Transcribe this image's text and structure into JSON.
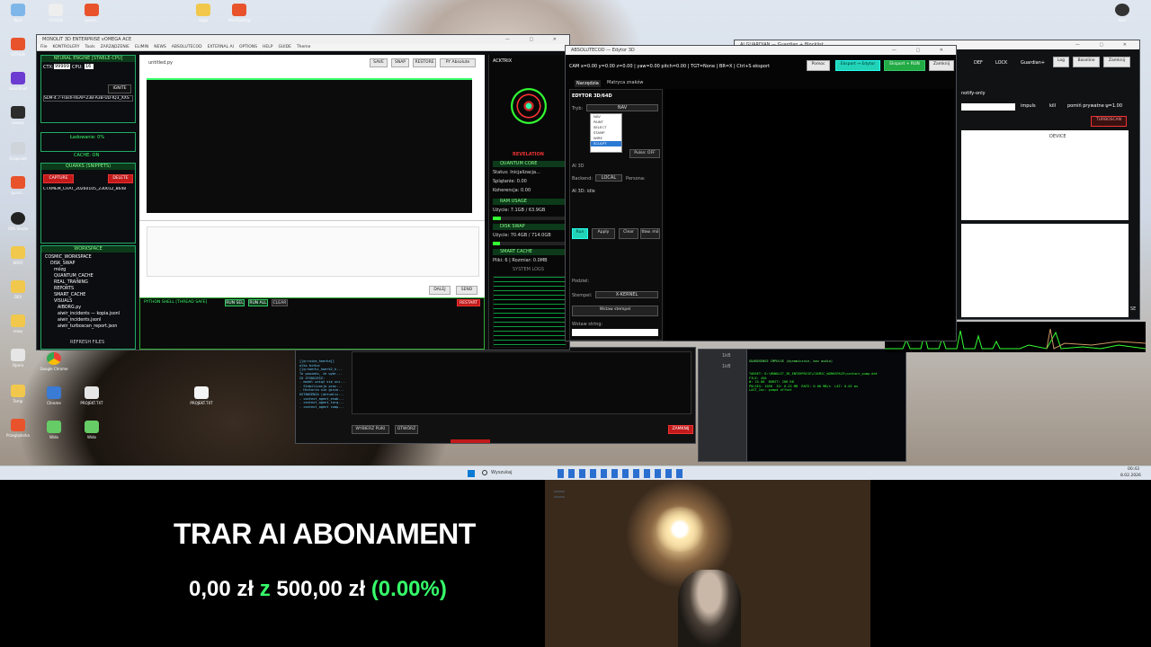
{
  "desktop": {
    "icons": [
      "Kosz",
      "GITHUB",
      "guard...",
      "Gaga",
      "ShortSetting",
      "GuardFuel",
      "aiwasp",
      "Snapcode",
      "OBS Studio",
      "KODY",
      "DEV",
      "nowy",
      "Opera",
      "Google Chrome",
      "Chrome",
      "Temp",
      "PROJEKT.TXT",
      "Wido",
      "Przeglądarka"
    ],
    "file_label": "PROJEKT.TXT"
  },
  "ide": {
    "title": "MONOLIT 3D ENTERPRISE vOMEGA ACE",
    "menu": [
      "File",
      "KONTROLERY",
      "Tools",
      "ZARZĄDZENIE",
      "ELIMIN",
      "NEWS",
      "ABSOLUTECOD",
      "EXTERNAL AI",
      "OPTIONS",
      "HELP",
      "GUIDE",
      "Theme"
    ],
    "engine_title": "NEURAL ENGINE [STABLE-CPU]",
    "ctx_label": "CTX:",
    "ctx_value": "99999",
    "cpu_label": "CPU:",
    "cpu_value": "16",
    "model": "SLM-4.7-Flash-REAP-23B-A3B-UD-IQ3_XXS",
    "ignite": "IGNITE",
    "loading": "Ładowanie: 0%",
    "cache": "CACHE: ON",
    "quarks": "QUARKS (SNIPPETS)",
    "capture": "CAPTURE",
    "delete": "DELETE",
    "snippet": "CTXMEM_CHAT_20260105_230012_8648",
    "workspace": "WORKSPACE",
    "tree": [
      "COSMIC_WORKSPACE",
      "DISK_SWAP",
      "mózg",
      "QUANTUM_CACHE",
      "REAL_TRAINING",
      "REPORTS",
      "SMART_CACHE",
      "VISUALS",
      "AIBORG.py",
      "aiwir_incidents — kopia.jsonl",
      "aiwir_incidents.jsonl",
      "aiwir_turboscan_report.json"
    ],
    "refresh": "REFRESH FILES",
    "file_tab": "untitled.py",
    "save": "SAVE",
    "snap": "SNAP",
    "restore": "RESTORE",
    "py_absolute": "PY Absolute",
    "dalej": "DALEJ",
    "send": "SEND",
    "shell_title": "PYTHON SHELL [THREAD SAFE]",
    "run_sel": "RUN SEL",
    "run_all": "RUN ALL",
    "clear": "CLEAR",
    "restart": "RESTART"
  },
  "monitor": {
    "acktrix": "ACKTRIX",
    "revelation": "REVELATION",
    "qcore": "QUANTUM CORE",
    "status": "Status: Inicjalizacja...",
    "splatanie": "Splątanie: 0.00",
    "koherencja": "Koherencja: 0.00",
    "ram": "RAM USAGE",
    "ram_val": "Użycie: 7.1GB / 63.9GB",
    "disk": "DISK SWAP",
    "disk_val": "Użycie: 70.4GB / 714.0GB",
    "smart": "SMART CACHE",
    "smart_val": "Pliki: 6 | Rozmiar: 0.0MB",
    "logs": "SYSTEM LOGS"
  },
  "editor3d": {
    "title": "ABSOLUTECOD — Edytor 3D",
    "status": "CAM x=0.00 y=0.00 z=0.00 | yaw=0.00 pitch=0.00 | TGT=None | BR=X | Ctrl+S eksport",
    "pomoc": "Pomoc",
    "eksport": "Eksport → Edytor",
    "eksport_run": "Eksport + RUN",
    "zamknij": "Zamknij",
    "tab1": "Narzędzia",
    "tab2": "Matryca znaków",
    "panel_title": "EDYTOR 3D/64D",
    "tryb": "Tryb:",
    "tryb_val": "NAV",
    "options": [
      "NAV",
      "PAINT",
      "SELECT",
      "STAMP",
      "WIRE",
      "SCULPT"
    ],
    "ai3d": "AI 3D",
    "backend": "Backend:",
    "backend_val": "LOCAL",
    "persona": "Persona:",
    "ai_status": "AI 3D: idle",
    "pulse": "Pulse: OFF",
    "run": "Run",
    "apply": "Apply",
    "clear": "Clear",
    "tlw": "tław. mó",
    "podziel": "Podziel:",
    "stempel": "Stempel:",
    "stempel_val": "X-KERNEL",
    "wstaw": "Wstaw stempel",
    "wstaw_string": "Wstaw string:"
  },
  "guardian": {
    "title": "AI GUARDIAN — Guardian + Blocklist",
    "def": "DEF",
    "lock": "LOCK",
    "guardian": "Guardian+",
    "log": "Log",
    "baseline": "Baseline",
    "zamknij": "Zamknij",
    "notify": "notify-only",
    "impuls": "impuls",
    "kill": "kill",
    "pomin": "pomiń prywatne ψ=1.00",
    "turboscan": "TURBOSCAN",
    "col_device": "DEVICE",
    "se": "SE"
  },
  "chat": {
    "sprint": "[[q:ruina_hoerka]]",
    "lines": [
      "[[q:ruina_hoerka]]",
      "alko bitka:",
      "[[q:hoerki_hoerk2_k...",
      "To powiedz, że wybr...",
      "",
      "CO ZYSKUJESZ:",
      "- model wciąż się ucz...",
      "- Stabilizacja prac...",
      "- Historia nie ginie...",
      "",
      "USTAWIENIA (aktualiz...",
      "- context_agent_enab...",
      "- context_agent_targ...",
      "- context_agent comp..."
    ],
    "wybierz": "WYBIERZ PLIKI",
    "otworz": "OTWÓRZ",
    "zamknij": "ZAMKNIJ"
  },
  "impulse": {
    "title": "GUARDSENSE IMPULSE (dynamicznie, bez audio)",
    "target": "TARGET: D:\\MONOLIT_3D_ENTERPRISE\\COSMIC_WORKSPACE\\contact_pump.dat",
    "file": "FILE: 456",
    "window": "W: 25.00  BURST: 286 KB",
    "pulses": "PULSES: 1050  IO: 0.23 MB  RATE: 0.00 MB/s  LAT: 0.02 ms",
    "last": "LAST_Ioc: pumpd offset",
    "col1": "1kB",
    "col2": "1kB"
  },
  "taskbar": {
    "search": "Wyszukaj",
    "time": "00:43",
    "date": "8.02.2026"
  },
  "overlay": {
    "title": "TRAR AI ABONAMENT",
    "current": "0,00 zł",
    "z": "z",
    "goal": "500,00 zł",
    "pct": "(0.00%)"
  }
}
